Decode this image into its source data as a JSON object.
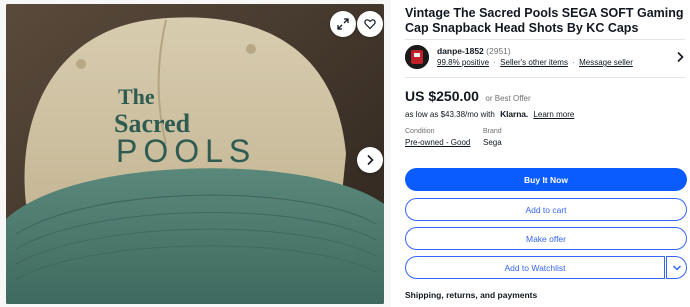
{
  "listing": {
    "title": "Vintage The Sacred Pools SEGA SOFT Gaming Cap Snapback Head Shots By KC Caps"
  },
  "photo": {
    "embroidery_line1": "The",
    "embroidery_line2": "Sacred",
    "embroidery_line3": "POOLS"
  },
  "seller": {
    "name": "danpe-1852",
    "feedback_count": "(2951)",
    "positive": "99.8% positive",
    "other_items": "Seller's other items",
    "message": "Message seller"
  },
  "price": {
    "amount": "US $250.00",
    "offer_note": "or Best Offer"
  },
  "financing": {
    "prefix": "as low as $43.38/mo with",
    "provider": "Klarna.",
    "learn_more": "Learn more"
  },
  "specs": {
    "condition_label": "Condition",
    "condition_value": "Pre-owned - Good",
    "brand_label": "Brand",
    "brand_value": "Sega"
  },
  "actions": {
    "buy_now": "Buy It Now",
    "add_to_cart": "Add to cart",
    "make_offer": "Make offer",
    "add_to_watchlist": "Add to Watchlist"
  },
  "sections": {
    "shipping": "Shipping, returns, and payments"
  },
  "icons": {
    "expand": "expand-icon",
    "favorite": "heart-icon",
    "next": "chevron-right-icon",
    "seller_nav": "chevron-right-icon",
    "watchlist_menu": "chevron-down-icon"
  },
  "colors": {
    "primary_button": "#0b5cff",
    "outline_button": "#3665f3",
    "text": "#111820",
    "muted": "#707070",
    "cap_crown": "#cdc0a0",
    "cap_brim": "#4d7b6f",
    "embroidery": "#2f5c52"
  }
}
